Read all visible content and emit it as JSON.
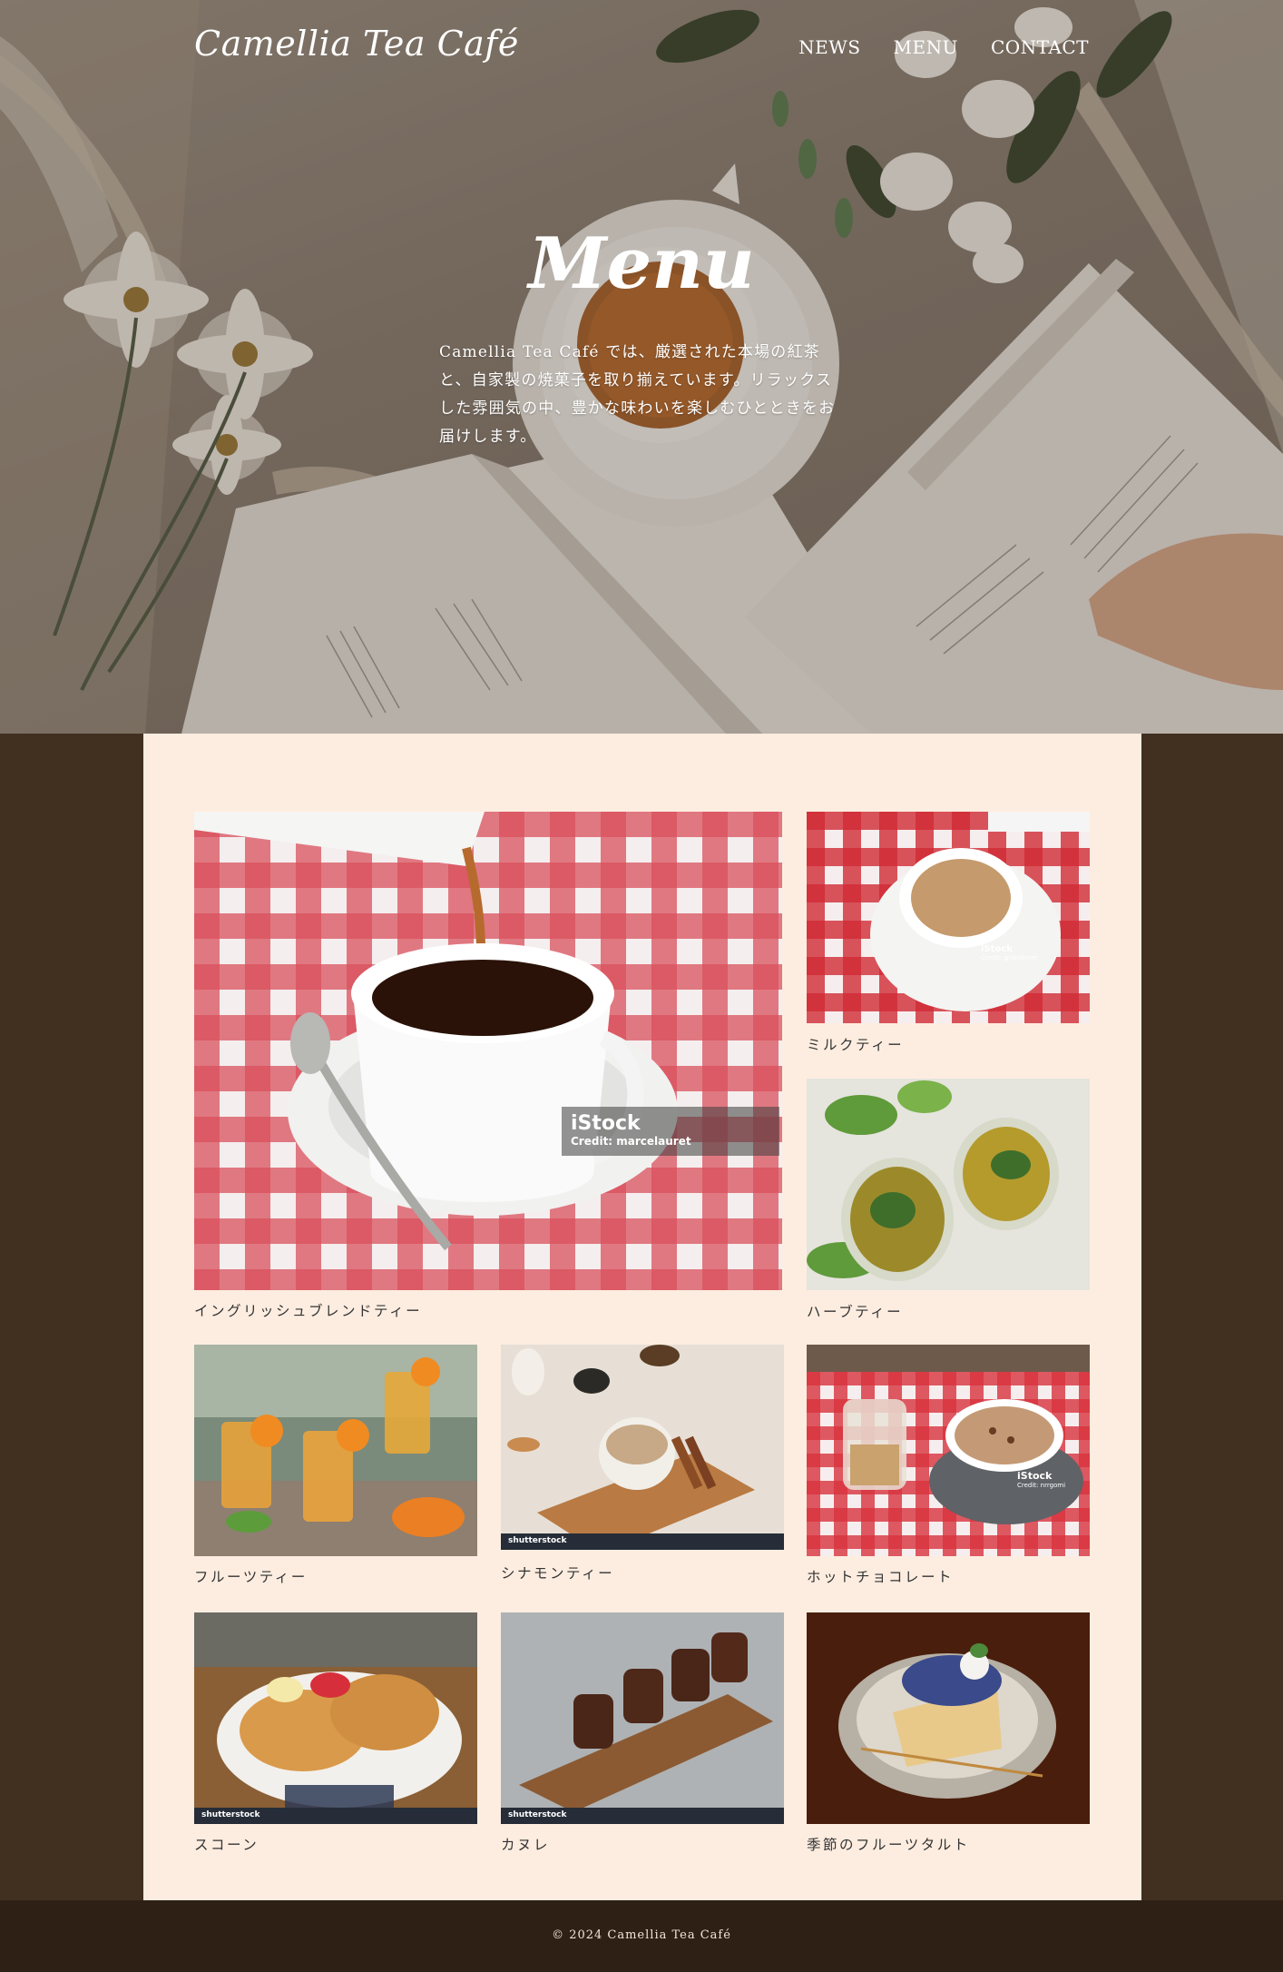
{
  "header": {
    "logo": "Camellia Tea Café",
    "nav": [
      "NEWS",
      "MENU",
      "CONTACT"
    ]
  },
  "hero": {
    "title": "Menu",
    "text": "Camellia Tea Café では、厳選された本場の紅茶と、自家製の焼菓子を取り揃えています。リラックスした雰囲気の中、豊かな味わいを楽しむひとときをお届けします。"
  },
  "menu": {
    "items": [
      {
        "caption": "イングリッシュブレンドティー"
      },
      {
        "caption": "ミルクティー"
      },
      {
        "caption": "ハーブティー"
      },
      {
        "caption": "フルーツティー"
      },
      {
        "caption": "シナモンティー"
      },
      {
        "caption": "ホットチョコレート"
      },
      {
        "caption": "スコーン"
      },
      {
        "caption": "カヌレ"
      },
      {
        "caption": "季節のフルーツタルト"
      }
    ],
    "watermarks": {
      "istock_brand": "iStock",
      "credit_main": "Credit: marcelauret",
      "credit_milk": "Credit: grandriver",
      "credit_choco": "Credit: nrrgomi",
      "shutterstock": "shutterstock"
    }
  },
  "footer": {
    "copyright": "© 2024 Camellia Tea Café"
  },
  "colors": {
    "page_bg": "#412f20",
    "panel_bg": "#fdede0",
    "footer_bg": "#2e2014",
    "caption_text": "#333333"
  }
}
